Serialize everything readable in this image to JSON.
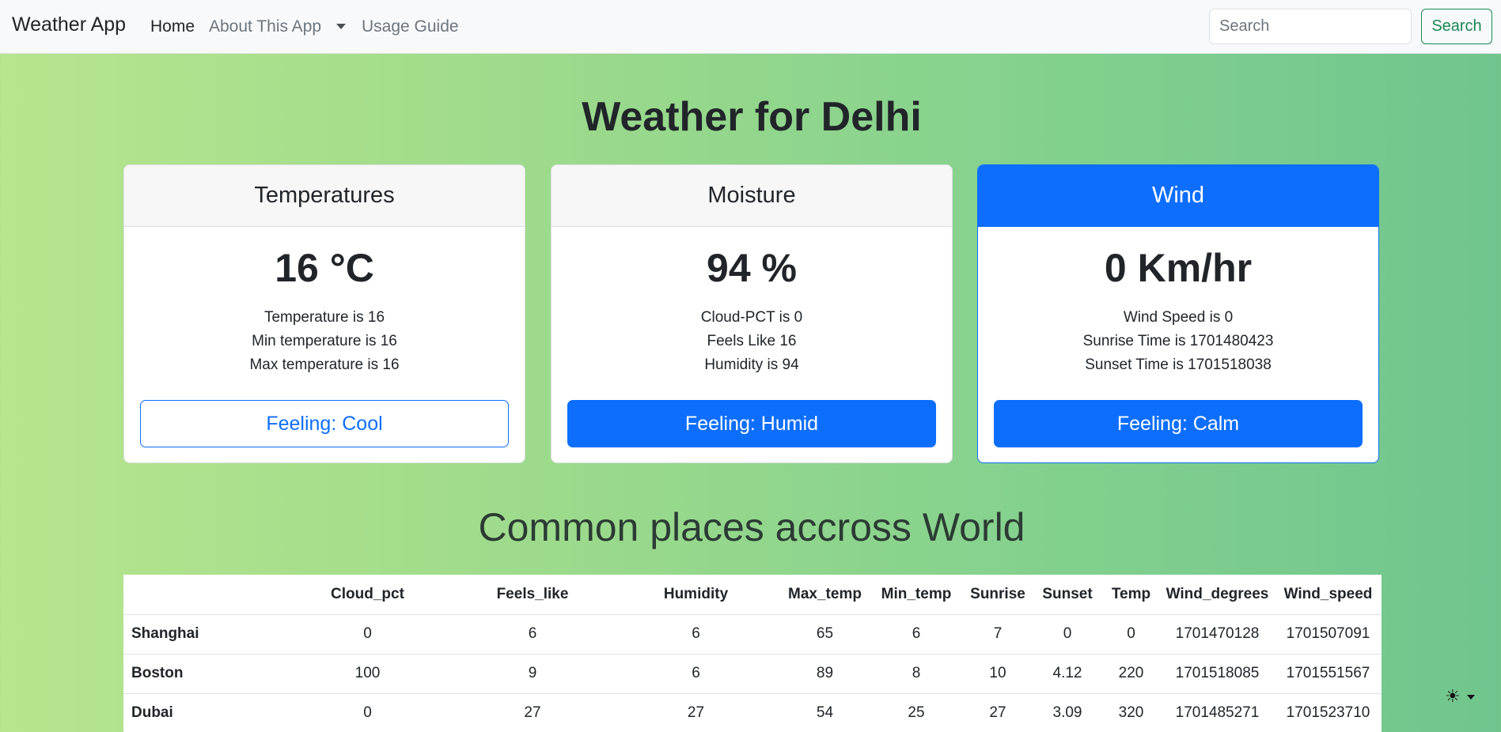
{
  "navbar": {
    "brand": "Weather App",
    "links": {
      "home": "Home",
      "about": "About This App",
      "guide": "Usage Guide"
    },
    "search": {
      "placeholder": "Search",
      "button_label": "Search"
    }
  },
  "page": {
    "title": "Weather for Delhi"
  },
  "cards": {
    "temperatures": {
      "header": "Temperatures",
      "value": "16 °C",
      "lines": [
        "Temperature is 16",
        "Min temperature is 16",
        "Max temperature is 16"
      ],
      "button": "Feeling: Cool"
    },
    "moisture": {
      "header": "Moisture",
      "value": "94 %",
      "lines": [
        "Cloud-PCT is 0",
        "Feels Like 16",
        "Humidity is 94"
      ],
      "button": "Feeling: Humid"
    },
    "wind": {
      "header": "Wind",
      "value": "0 Km/hr",
      "lines": [
        "Wind Speed is 0",
        "Sunrise Time is 1701480423",
        "Sunset Time is 1701518038"
      ],
      "button": "Feeling: Calm"
    }
  },
  "common_places": {
    "title": "Common places accross World",
    "columns": [
      "",
      "Cloud_pct",
      "Feels_like",
      "Humidity",
      "Max_temp",
      "Min_temp",
      "Sunrise",
      "Sunset",
      "Temp",
      "Wind_degrees",
      "Wind_speed"
    ],
    "rows": [
      [
        "Shanghai",
        "0",
        "6",
        "6",
        "65",
        "6",
        "7",
        "0",
        "0",
        "1701470128",
        "1701507091"
      ],
      [
        "Boston",
        "100",
        "9",
        "6",
        "89",
        "8",
        "10",
        "4.12",
        "220",
        "1701518085",
        "1701551567"
      ],
      [
        "Dubai",
        "0",
        "27",
        "27",
        "54",
        "25",
        "27",
        "3.09",
        "320",
        "1701485271",
        "1701523710"
      ]
    ]
  },
  "theme_toggle": {
    "icon": "sun-icon",
    "glyph": "☀"
  },
  "colors": {
    "primary": "#0d6efd",
    "success": "#198754",
    "gradient_start": "#b7e58d",
    "gradient_end": "#70c58e"
  }
}
